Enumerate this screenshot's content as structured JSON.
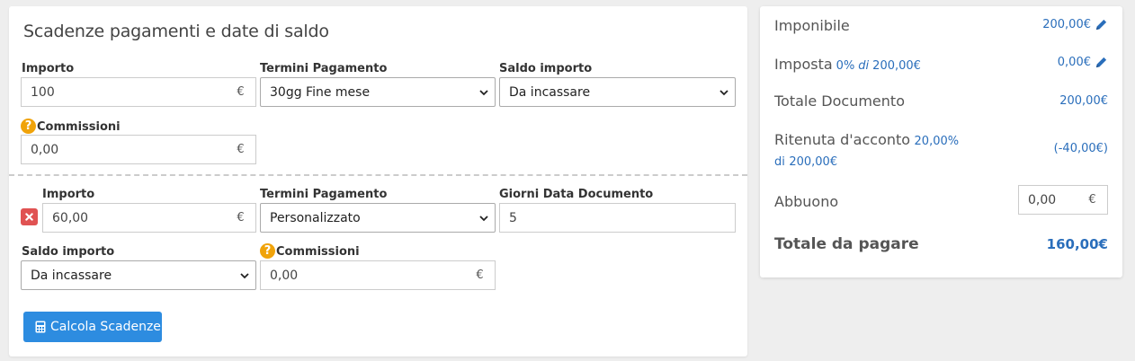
{
  "left": {
    "title": "Scadenze pagamenti e date di saldo",
    "block1": {
      "importo_label": "Importo",
      "importo_value": "100",
      "currency": "€",
      "termini_label": "Termini Pagamento",
      "termini_value": "30gg Fine mese",
      "saldo_label": "Saldo importo",
      "saldo_value": "Da incassare",
      "commissioni_label": "Commissioni",
      "commissioni_value": "0,00",
      "help_glyph": "?"
    },
    "block2": {
      "importo_label": "Importo",
      "importo_value": "60,00",
      "currency": "€",
      "termini_label": "Termini Pagamento",
      "termini_value": "Personalizzato",
      "giorni_label": "Giorni Data Documento",
      "giorni_value": "5",
      "saldo_label": "Saldo importo",
      "saldo_value": "Da incassare",
      "commissioni_label": "Commissioni",
      "commissioni_value": "0,00",
      "help_glyph": "?"
    },
    "calc_button": "Calcola Scadenze"
  },
  "right": {
    "imponibile_label": "Imponibile",
    "imponibile_value": "200,00€",
    "imposta_label": "Imposta",
    "imposta_detail_pct": "0%",
    "imposta_detail_di": "di",
    "imposta_detail_base": "200,00€",
    "imposta_value": "0,00€",
    "totale_doc_label": "Totale Documento",
    "totale_doc_value": "200,00€",
    "ritenuta_label": "Ritenuta d'acconto",
    "ritenuta_detail_pct": "20,00% di",
    "ritenuta_detail_base": "200,00€",
    "ritenuta_value": "(-40,00€)",
    "abbuono_label": "Abbuono",
    "abbuono_value": "0,00",
    "currency": "€",
    "totale_pagare_label": "Totale da pagare",
    "totale_pagare_value": "160,00€"
  },
  "colors": {
    "accent_blue": "#2a6ebb",
    "button_blue": "#2d8ce0",
    "help_orange": "#f0a30a",
    "delete_red": "#e05252"
  },
  "icons": [
    "help-icon",
    "delete-icon",
    "chevron-down-icon",
    "calculator-icon",
    "pencil-icon"
  ]
}
